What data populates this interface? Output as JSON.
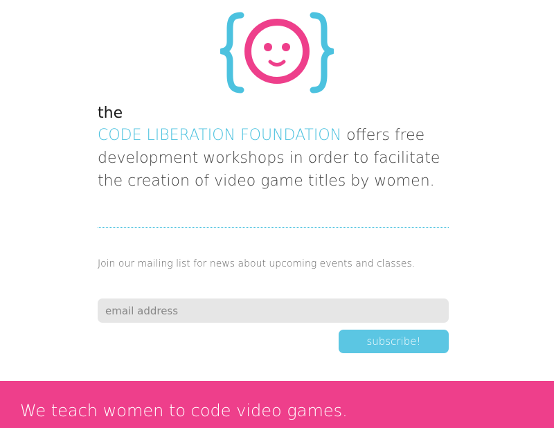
{
  "logo": {
    "icon": "smiley-braces-logo",
    "colors": {
      "braces": "#4cc2df",
      "face": "#ee3f8b"
    }
  },
  "intro": {
    "the": "the",
    "brand": "CODE LIBERATION FOUNDATION",
    "statement_rest": " offers free development workshops in order to facilitate the creation of video game titles by women."
  },
  "mailing": {
    "text": "Join our mailing list for news about upcoming events and classes.",
    "email_placeholder": "email address",
    "email_value": "",
    "subscribe_label": "subscribe!"
  },
  "banner": {
    "text": "We teach women to code video games."
  },
  "colors": {
    "accent_blue": "#4cc2df",
    "accent_pink": "#ee3f8b",
    "button": "#5bc6e3",
    "field_bg": "#e6e6e6"
  }
}
